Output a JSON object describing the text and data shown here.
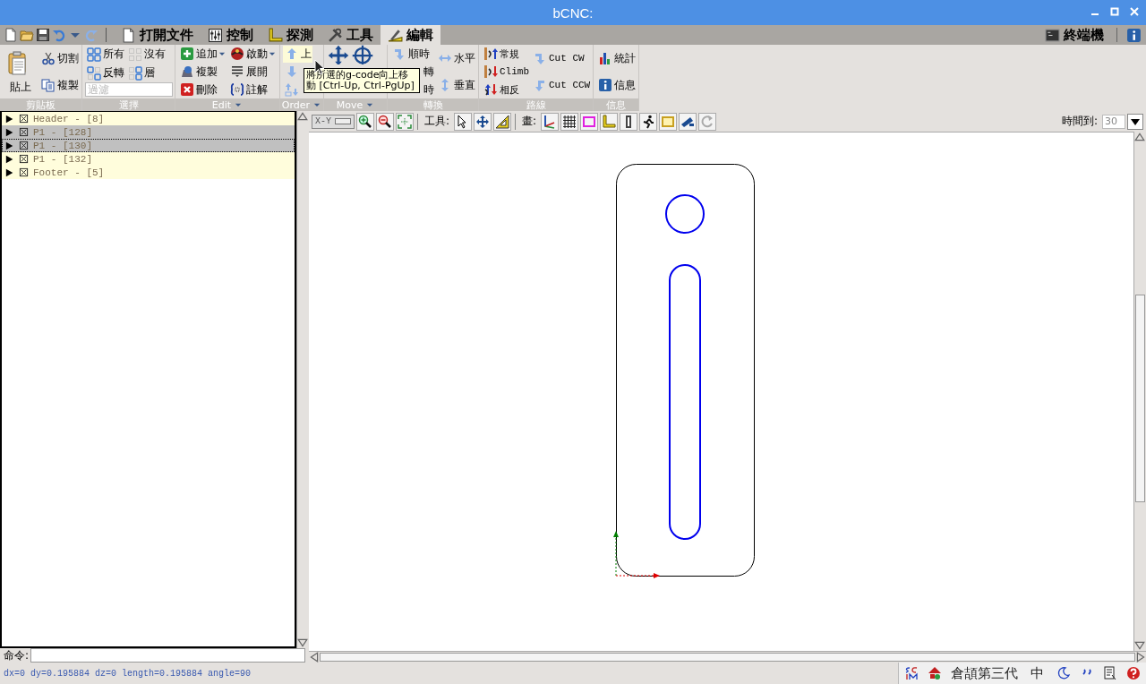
{
  "window": {
    "title": "bCNC:"
  },
  "tabs": [
    {
      "label": "打開文件",
      "selected": false
    },
    {
      "label": "控制",
      "selected": false
    },
    {
      "label": "探測",
      "selected": false
    },
    {
      "label": "工具",
      "selected": false
    },
    {
      "label": "編輯",
      "selected": true
    }
  ],
  "terminal_tab": {
    "label": "終端機"
  },
  "ribbon": {
    "groups": [
      {
        "label": "剪貼板",
        "menu": false,
        "columns": [
          [
            {
              "label": "貼上",
              "kind": "large"
            }
          ],
          [
            {
              "label": "切割",
              "kind": "small"
            },
            {
              "label": "複製",
              "kind": "small"
            }
          ]
        ]
      },
      {
        "label": "選擇",
        "menu": false,
        "columns": [
          [
            {
              "label": "所有",
              "kind": "small"
            },
            {
              "label": "反轉",
              "kind": "small"
            }
          ],
          [
            {
              "label": "沒有",
              "kind": "small"
            },
            {
              "label": "層",
              "kind": "small"
            }
          ]
        ],
        "filter": {
          "placeholder": "過濾"
        }
      },
      {
        "label": "Edit",
        "menu": true,
        "columns": [
          [
            {
              "label": "追加",
              "kind": "small",
              "dropdown": true
            },
            {
              "label": "複製",
              "kind": "small"
            },
            {
              "label": "刪除",
              "kind": "small"
            }
          ],
          [
            {
              "label": "啟動",
              "kind": "small",
              "dropdown": true
            },
            {
              "label": "展開",
              "kind": "small"
            },
            {
              "label": "註解",
              "kind": "small"
            }
          ]
        ]
      },
      {
        "label": "Order",
        "menu": true,
        "columns": [
          [
            {
              "label": "上",
              "kind": "small",
              "highlighted": true
            },
            {
              "kind": "icon",
              "highlighted": false
            },
            {
              "kind": "icon",
              "highlighted": false
            }
          ]
        ]
      },
      {
        "label": "Move",
        "menu": true,
        "columns": [
          [
            {
              "kind": "large_icon"
            }
          ],
          [
            {
              "kind": "large_icon"
            }
          ]
        ]
      },
      {
        "label": "轉換",
        "menu": false,
        "columns": [
          [
            {
              "label": "順時",
              "kind": "small"
            },
            {
              "label": "轉",
              "kind": "small"
            },
            {
              "label": "時",
              "kind": "small"
            }
          ],
          [
            {
              "label": "水平",
              "kind": "small"
            },
            {
              "label": "垂直",
              "kind": "small"
            }
          ]
        ]
      },
      {
        "label": "路線",
        "menu": false,
        "columns": [
          [
            {
              "label": "常規",
              "kind": "small"
            },
            {
              "label": "Climb",
              "kind": "small"
            },
            {
              "label": "相反",
              "kind": "small"
            }
          ],
          [
            {
              "label": "Cut CW",
              "kind": "small"
            },
            {
              "label": "Cut CCW",
              "kind": "small"
            }
          ]
        ]
      },
      {
        "label": "信息",
        "menu": false,
        "columns": [
          [
            {
              "label": "統計",
              "kind": "small"
            },
            {
              "label": "信息",
              "kind": "small"
            }
          ]
        ]
      }
    ]
  },
  "tooltip": {
    "text": "將所選的g-code向上移動 [Ctrl-Up, Ctrl-PgUp]"
  },
  "tree": {
    "items": [
      {
        "label": "Header - [8]",
        "expanded": false,
        "enabled": true,
        "selected": false,
        "focused": false
      },
      {
        "label": "P1 - [128]",
        "expanded": false,
        "enabled": true,
        "selected": true,
        "focused": false
      },
      {
        "label": "P1 - [130]",
        "expanded": false,
        "enabled": true,
        "selected": true,
        "focused": true
      },
      {
        "label": "P1 - [132]",
        "expanded": false,
        "enabled": true,
        "selected": false,
        "focused": false
      },
      {
        "label": "Footer - [5]",
        "expanded": false,
        "enabled": true,
        "selected": false,
        "focused": false
      }
    ]
  },
  "command": {
    "label": "命令:"
  },
  "canvas_toolbar": {
    "view": "X-Y",
    "tools_label": "工具:",
    "draw_label": "畫:",
    "timeout_label": "時間到:",
    "timeout": "30"
  },
  "status_bar": {
    "text": "dx=0 dy=0.195884 dz=0 length=0.195884 angle=90",
    "input_method": "倉頡第三代",
    "mode": "中"
  }
}
